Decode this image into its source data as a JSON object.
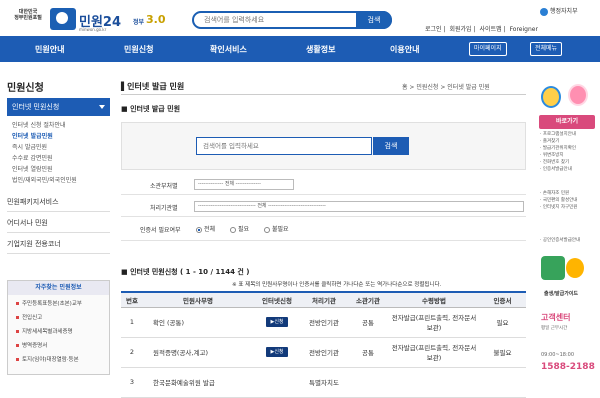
{
  "header": {
    "emblem_line1": "대한민국",
    "emblem_line2": "정부민원포털",
    "logo_name": "민원24",
    "logo_url_text": "minwon.go.kr",
    "gov_version": "정부",
    "gov_version_number": "3.0",
    "search_placeholder": "검색어를 입력하세요",
    "search_button": "검색",
    "ministry": "행정자치부",
    "links": [
      "로그인",
      "회원가입",
      "사이트맵",
      "Foreigner"
    ]
  },
  "nav": {
    "items": [
      "민원안내",
      "민원신청",
      "확인서비스",
      "생활정보",
      "이용안내"
    ],
    "mypage": "마이페이지",
    "allmenu": "전체메뉴"
  },
  "sidebar": {
    "title": "민원신청",
    "active": "인터넷 민원신청",
    "subs": [
      "인터넷 신청 절차안내",
      "인터넷 발급민원",
      "즉시 발급민원",
      "수수료 감면민원",
      "인터넷 열람민원",
      "법인/재외국민/외국인민원"
    ],
    "rows": [
      "민원패키지서비스",
      "어디서나 민원",
      "기업지원 전용코너"
    ],
    "faq_title": "자주찾는 민원정보",
    "faq": [
      "주민등록표등본(초본)교부",
      "전입신고",
      "지방세세목별과세증명",
      "병역증명서",
      "토지(임야)대장열람·등본"
    ]
  },
  "main": {
    "title": "인터넷 발급 민원",
    "breadcrumb": "홈 > 민원신청 > 인터넷 발급 민원",
    "subtitle": "인터넷 발급 민원",
    "search_placeholder": "검색어를 입력하세요",
    "search_button": "검색",
    "filter_labels": [
      "소관부처별",
      "처리기관별",
      "인증서 필요여부"
    ],
    "filter_values": [
      "-------------- 전체 --------------",
      "-------------------------------- 전체 --------------------------------"
    ],
    "radio": [
      "전체",
      "필요",
      "불필요"
    ],
    "list_title": "인터넷 민원신청 ( 1 - 10 / 1144 건 )",
    "notice": "※ 표 제목의 민원사무명이나 인증서를 클릭하면 가나다순 또는 역가나다순으로 정렬됩니다.",
    "columns": [
      "번호",
      "민원사무명",
      "인터넷신청",
      "처리기관",
      "소관기관",
      "수령방법",
      "인증서"
    ],
    "rows": [
      {
        "no": "1",
        "name": "확인 (공통)",
        "apply": "▶신청",
        "proc": "전방인기관",
        "own": "공통",
        "recv": "전자발급(프린트출력, 전자문서보관)",
        "cert": "필요"
      },
      {
        "no": "2",
        "name": "원적증명(공사,계고)",
        "apply": "▶신청",
        "proc": "전방인기관",
        "own": "공통",
        "recv": "전자발급(프린트출력, 전자문서보관)",
        "cert": "불필요"
      },
      {
        "no": "3",
        "name": "한국문화예술위원 발급",
        "apply": "",
        "proc": "특별자치도",
        "own": "",
        "recv": "",
        "cert": ""
      }
    ]
  },
  "right": {
    "quick": "바로가기",
    "quick_items": [
      "· 프로그램설치안내",
      "· 즐겨찾기",
      "· 발급기관위치확인",
      "· 위변조방지",
      "· 전화번호 찾기",
      "· 인증서발급안내"
    ],
    "extra_items": [
      "· 손해자조 민원",
      "· 국민편의 활성안내",
      "· 인터넷지 자구민원"
    ],
    "guide": "· 공인인증서발급안내",
    "ribbon": "출생/발급가이드",
    "center_label": "고객센터",
    "center_sub": "평일 근무시간",
    "hours": "09:00~18:00",
    "phone": "1588-2188"
  }
}
